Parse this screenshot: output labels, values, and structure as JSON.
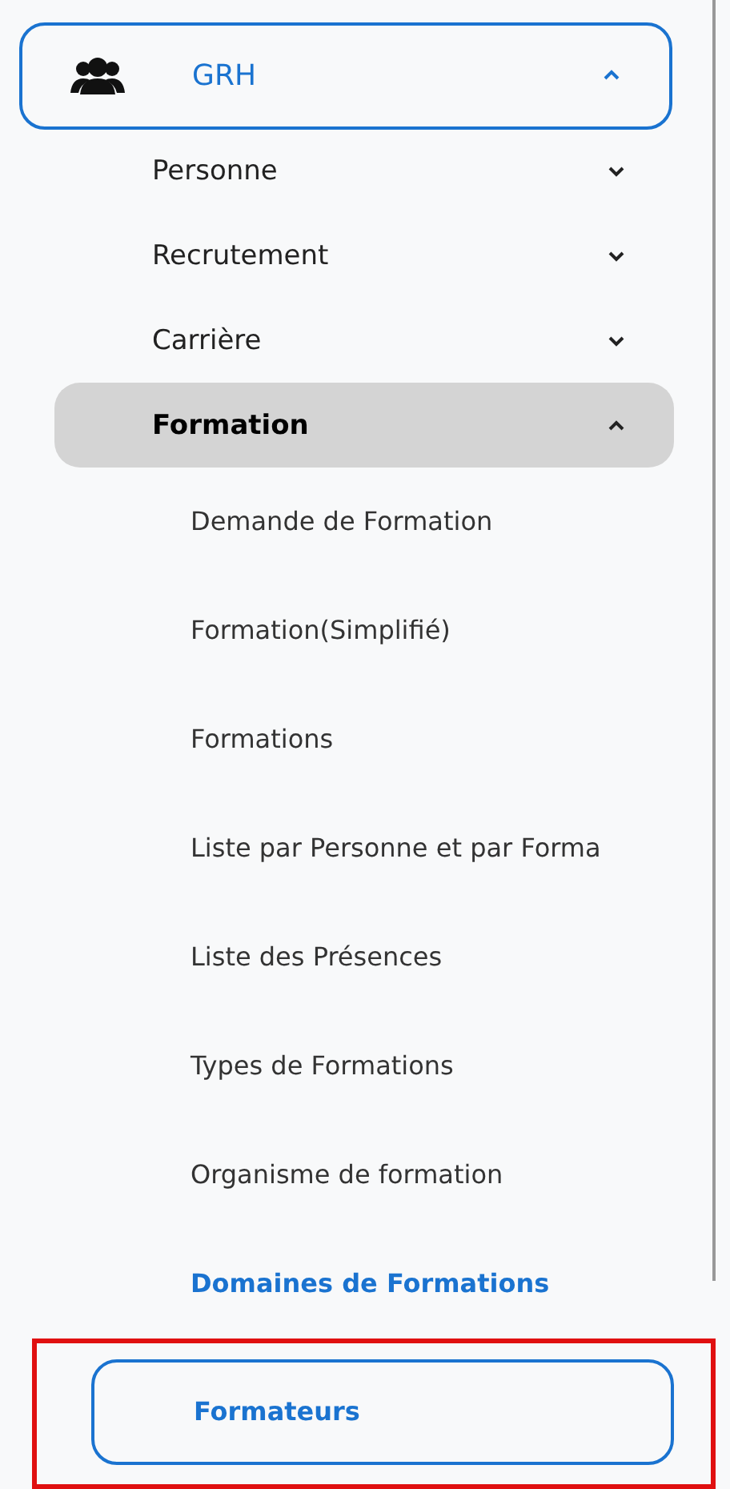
{
  "module": {
    "label": "GRH",
    "expanded": true,
    "selected": true
  },
  "sections": [
    {
      "label": "Personne",
      "expanded": false,
      "selected": false
    },
    {
      "label": "Recrutement",
      "expanded": false,
      "selected": false
    },
    {
      "label": "Carrière",
      "expanded": false,
      "selected": false
    },
    {
      "label": "Formation",
      "expanded": true,
      "selected": true,
      "children": [
        {
          "label": "Demande de Formation",
          "active": false,
          "selected": false,
          "annotated": false
        },
        {
          "label": "Formation(Simplifié)",
          "active": false,
          "selected": false,
          "annotated": false
        },
        {
          "label": "Formations",
          "active": false,
          "selected": false,
          "annotated": false
        },
        {
          "label": "Liste par Personne et par Forma",
          "active": false,
          "selected": false,
          "annotated": false
        },
        {
          "label": "Liste des Présences",
          "active": false,
          "selected": false,
          "annotated": false
        },
        {
          "label": "Types de Formations",
          "active": false,
          "selected": false,
          "annotated": false
        },
        {
          "label": "Organisme de formation",
          "active": false,
          "selected": false,
          "annotated": false
        },
        {
          "label": "Domaines de Formations",
          "active": true,
          "selected": false,
          "annotated": false
        },
        {
          "label": "Formateurs",
          "active": true,
          "selected": true,
          "annotated": true
        }
      ]
    }
  ]
}
